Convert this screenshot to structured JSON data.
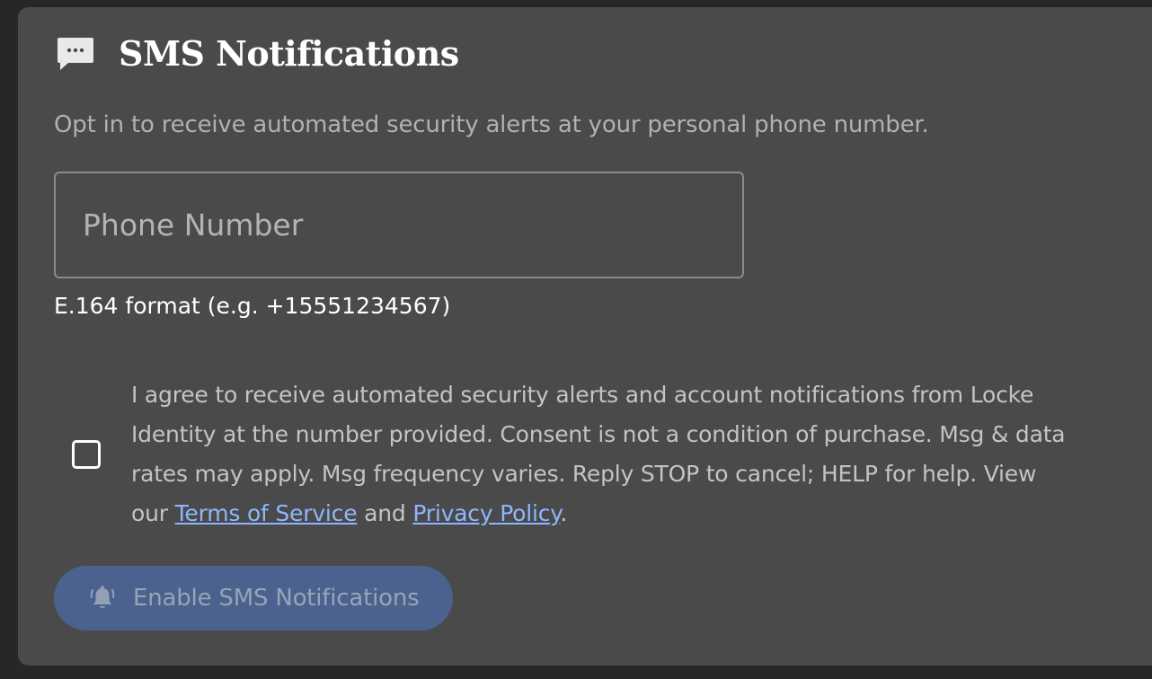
{
  "header": {
    "icon": "chat-bubble-icon",
    "title": "SMS Notifications"
  },
  "subtitle": "Opt in to receive automated security alerts at your personal phone number.",
  "phone": {
    "placeholder": "Phone Number",
    "value": "",
    "hint": "E.164 format (e.g. +15551234567)"
  },
  "consent": {
    "checked": false,
    "text_before": "I agree to receive automated security alerts and account notifications from Locke Identity at the number provided. Consent is not a condition of purchase. Msg & data rates may apply. Msg frequency varies. Reply STOP to cancel; HELP for help. View our ",
    "terms_label": "Terms of Service",
    "text_middle": " and ",
    "privacy_label": "Privacy Policy",
    "text_after": "."
  },
  "enable_button": {
    "icon": "bell-ring-icon",
    "label": "Enable SMS Notifications",
    "disabled": true
  },
  "colors": {
    "card_bg": "#4a4a4a",
    "link": "#8eb6ff",
    "button_bg": "#4a628d"
  }
}
